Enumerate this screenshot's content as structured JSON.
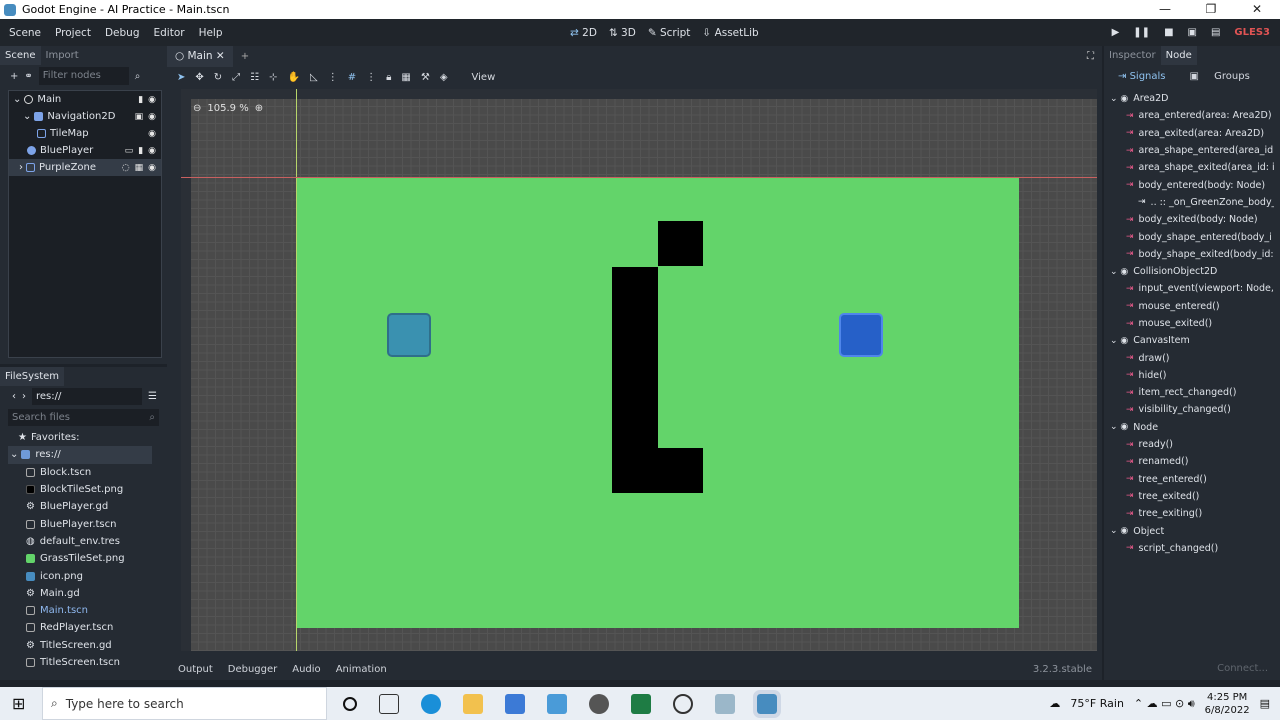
{
  "window": {
    "title": "Godot Engine - AI Practice - Main.tscn"
  },
  "menus": [
    "Scene",
    "Project",
    "Debug",
    "Editor",
    "Help"
  ],
  "modes": [
    "2D",
    "3D",
    "Script",
    "AssetLib"
  ],
  "renderer": "GLES3",
  "scene_dock": {
    "tabs": [
      "Scene",
      "Import"
    ],
    "filter_placeholder": "Filter nodes",
    "nodes": [
      "Main",
      "Navigation2D",
      "TileMap",
      "BluePlayer",
      "PurpleZone"
    ]
  },
  "filesystem": {
    "tab": "FileSystem",
    "path": "res://",
    "search_placeholder": "Search files",
    "favorites": "Favorites:",
    "root": "res://",
    "files": [
      "Block.tscn",
      "BlockTileSet.png",
      "BluePlayer.gd",
      "BluePlayer.tscn",
      "default_env.tres",
      "GrassTileSet.png",
      "icon.png",
      "Main.gd",
      "Main.tscn",
      "RedPlayer.tscn",
      "TitleScreen.gd",
      "TitleScreen.tscn"
    ]
  },
  "editor": {
    "tab": "Main",
    "view_label": "View",
    "zoom": "105.9 %",
    "bottom_tabs": [
      "Output",
      "Debugger",
      "Audio",
      "Animation"
    ],
    "version": "3.2.3.stable"
  },
  "inspector": {
    "tabs": [
      "Inspector",
      "Node"
    ],
    "subtabs": [
      "Signals",
      "Groups"
    ],
    "signals": [
      {
        "kind": "class",
        "text": "Area2D"
      },
      {
        "kind": "item",
        "text": "area_entered(area: Area2D)"
      },
      {
        "kind": "item",
        "text": "area_exited(area: Area2D)"
      },
      {
        "kind": "item",
        "text": "area_shape_entered(area_id:"
      },
      {
        "kind": "item",
        "text": "area_shape_exited(area_id: i"
      },
      {
        "kind": "item",
        "text": "body_entered(body: Node)"
      },
      {
        "kind": "sub",
        "text": ".. :: _on_GreenZone_body_e"
      },
      {
        "kind": "item",
        "text": "body_exited(body: Node)"
      },
      {
        "kind": "item",
        "text": "body_shape_entered(body_i"
      },
      {
        "kind": "item",
        "text": "body_shape_exited(body_id:"
      },
      {
        "kind": "class",
        "text": "CollisionObject2D"
      },
      {
        "kind": "item",
        "text": "input_event(viewport: Node,"
      },
      {
        "kind": "item",
        "text": "mouse_entered()"
      },
      {
        "kind": "item",
        "text": "mouse_exited()"
      },
      {
        "kind": "class",
        "text": "CanvasItem"
      },
      {
        "kind": "item",
        "text": "draw()"
      },
      {
        "kind": "item",
        "text": "hide()"
      },
      {
        "kind": "item",
        "text": "item_rect_changed()"
      },
      {
        "kind": "item",
        "text": "visibility_changed()"
      },
      {
        "kind": "class",
        "text": "Node"
      },
      {
        "kind": "item",
        "text": "ready()"
      },
      {
        "kind": "item",
        "text": "renamed()"
      },
      {
        "kind": "item",
        "text": "tree_entered()"
      },
      {
        "kind": "item",
        "text": "tree_exited()"
      },
      {
        "kind": "item",
        "text": "tree_exiting()"
      },
      {
        "kind": "class",
        "text": "Object"
      },
      {
        "kind": "item",
        "text": "script_changed()"
      }
    ],
    "connect": "Connect..."
  },
  "taskbar": {
    "search_placeholder": "Type here to search",
    "weather": "75°F Rain",
    "time": "4:25 PM",
    "date": "6/8/2022"
  }
}
